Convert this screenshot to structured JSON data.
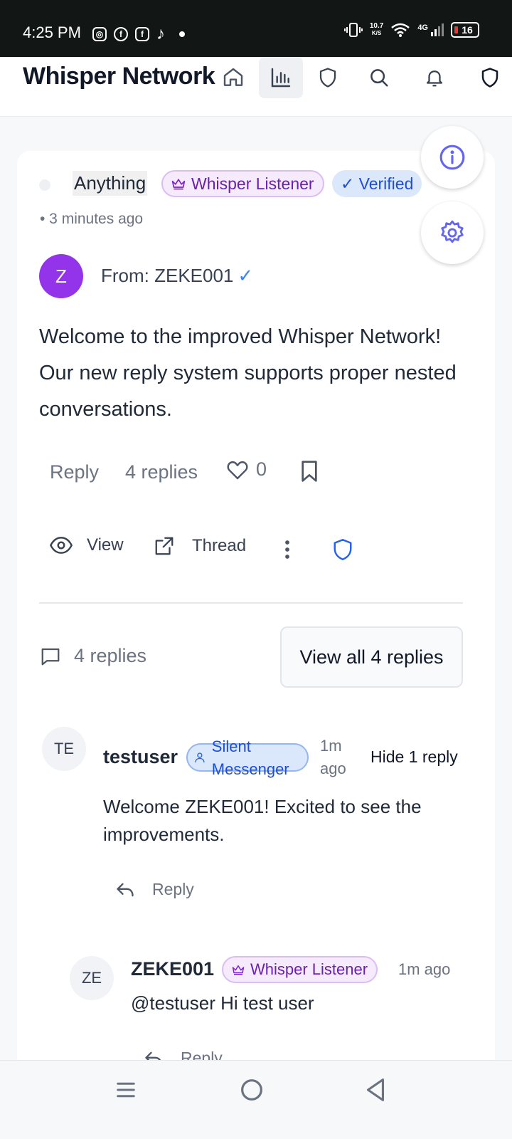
{
  "status_bar": {
    "time": "4:25 PM",
    "net_speed_value": "10.7",
    "net_speed_unit": "K/S",
    "network": "4G",
    "battery": "16"
  },
  "header": {
    "title": "Whisper Network",
    "nav_icons": [
      "home-icon",
      "bar-chart-icon",
      "shield-icon",
      "search-icon",
      "bell-icon",
      "shield-icon"
    ]
  },
  "post": {
    "topic": "Anything",
    "role_badge": "Whisper Listener",
    "verified_badge": "✓ Verified",
    "time": "• 3 minutes ago",
    "avatar_initial": "Z",
    "from": "From: ZEKE001",
    "verified_mark": "✓",
    "message": "Welcome to the improved Whisper Network! Our new reply system supports proper nested conversations.",
    "reply_label": "Reply",
    "replies_count": "4 replies",
    "likes": "0",
    "view_label": "View",
    "thread_label": "Thread"
  },
  "replies_section": {
    "count_label": "4 replies",
    "view_all_label": "View all 4 replies"
  },
  "replies": [
    {
      "initials": "TE",
      "username": "testuser",
      "badge": "Silent Messenger",
      "time": "1m ago",
      "hide_label": "Hide 1 reply",
      "text": "Welcome ZEKE001! Excited to see the improvements.",
      "reply_label": "Reply"
    },
    {
      "initials": "ZE",
      "username": "ZEKE001",
      "badge": "Whisper Listener",
      "time": "1m ago",
      "text": "@testuser Hi test user",
      "reply_label": "Reply"
    }
  ],
  "colors": {
    "accent_purple": "#9333ea",
    "badge_purple_text": "#6b21a8",
    "verified_blue": "#1d4ed8",
    "indigo_icon": "#6366f1"
  }
}
